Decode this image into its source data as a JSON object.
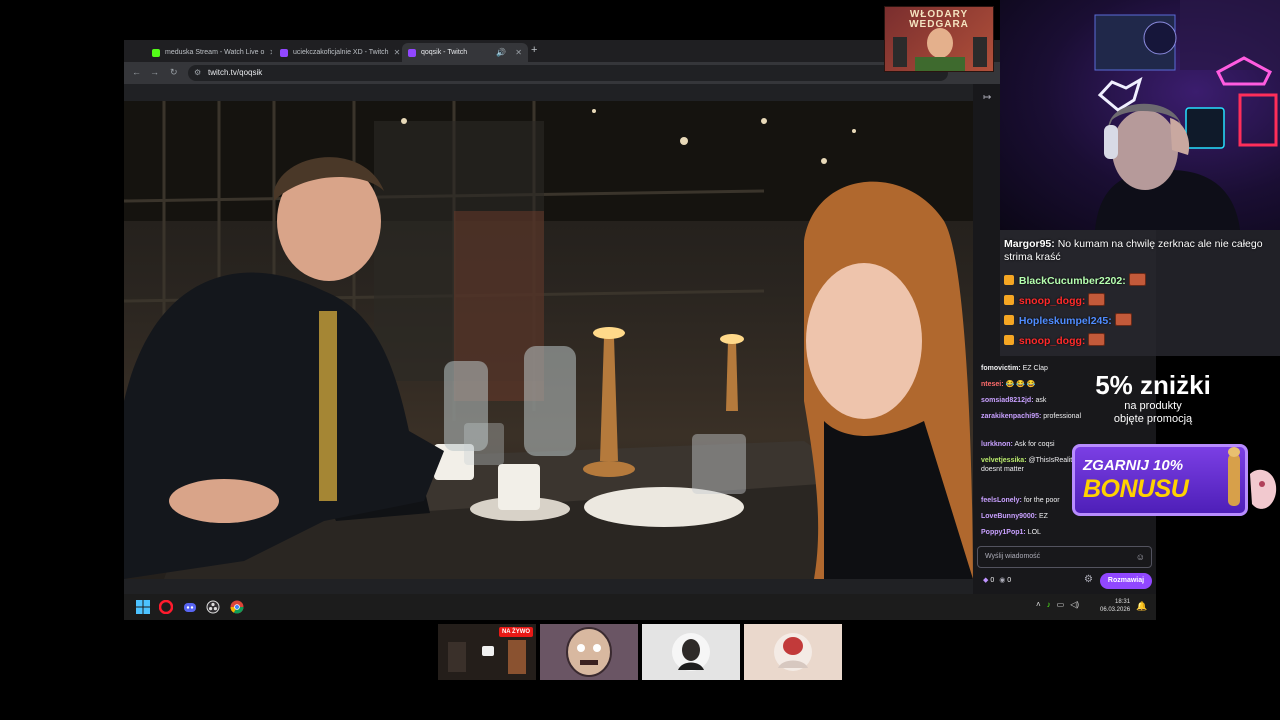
{
  "browser": {
    "tabs": [
      {
        "label": "meduska Stream - Watch Live o",
        "favicon": "kick-icon",
        "color": "#53fc18"
      },
      {
        "label": "uciekczakoficjalnie XD - Twitch",
        "favicon": "twitch-icon",
        "color": "#9147ff"
      },
      {
        "label": "qoqsik - Twitch",
        "favicon": "twitch-icon",
        "color": "#9147ff"
      }
    ],
    "url": "twitch.tv/qoqsik"
  },
  "twitch_chat": {
    "messages": [
      {
        "user": "fomovictim:",
        "text": "EZ Clap",
        "color": "#efeff1"
      },
      {
        "user": "ntesei:",
        "text": "😂 😂 😂",
        "color": "#ff6b6b"
      },
      {
        "user": "somsiad8212jd:",
        "text": "ask",
        "color": "#c8a0ff"
      },
      {
        "user": "zarakikenpachi95:",
        "text": "professional",
        "color": "#c8a0ff"
      },
      {
        "user": "lurkknon:",
        "text": "Ask for coqsi",
        "color": "#c8a0ff"
      },
      {
        "user": "velvetjessika:",
        "text": "@ThisIsRealityOfGambling the size doesnt matter",
        "color": "#b8e86b"
      },
      {
        "user": "feelsLonely:",
        "text": "for the poor",
        "color": "#c8a0ff"
      },
      {
        "user": "LoveBunny9000:",
        "text": "EZ",
        "color": "#c8a0ff"
      },
      {
        "user": "Poppy1Pop1:",
        "text": "LOL",
        "color": "#c8a0ff"
      }
    ],
    "input_placeholder": "Wyślij wiadomość",
    "points_a": "0",
    "points_b": "0",
    "send_label": "Rozmawiaj"
  },
  "taskbar": {
    "time": "18:31",
    "date": "06.03.2026"
  },
  "overlay": {
    "logo_text": "WŁODARY WEDGARA",
    "chat": [
      {
        "user": "Margor95:",
        "text": "No kumam na chwilę zerknac ale nie całego strima kraść",
        "color": "#ffffff"
      },
      {
        "user": "BlackCucumber2202:",
        "text": "",
        "color": "#ffffff"
      },
      {
        "user": "snoop_dogg:",
        "text": "",
        "color": "#ff2a2a"
      },
      {
        "user": "Hopleskumpel245:",
        "text": "",
        "color": "#4f8cff"
      },
      {
        "user": "snoop_dogg:",
        "text": "",
        "color": "#ff2a2a"
      }
    ],
    "promo_big": "5% zniżki",
    "promo_line1": "na produkty",
    "promo_line2": "objęte promocją",
    "bonus_top": "ZGARNIJ 10%",
    "bonus_main": "BONUSU"
  },
  "thumbnails": {
    "live_badge": "NA ŻYWO"
  }
}
